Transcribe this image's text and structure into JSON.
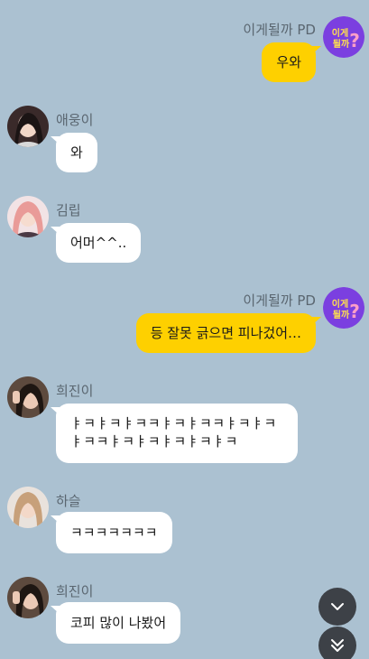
{
  "chat": {
    "messages": [
      {
        "sender": "이게될까 PD",
        "text": "우와",
        "side": "right"
      },
      {
        "sender": "애웅이",
        "text": "와",
        "side": "left"
      },
      {
        "sender": "김립",
        "text": "어머^^..",
        "side": "left"
      },
      {
        "sender": "이게될까 PD",
        "text": "등 잘못 긁으면 피나겄어…",
        "side": "right"
      },
      {
        "sender": "희진이",
        "text": "ㅑㅋㅑㅋㅑㅋㅋㅑㅋㅑㅋㅋㅑㅋㅑㅋㅑㅋㅋㅑㅋㅑㅋㅑㅋㅑㅋㅑㅋ",
        "side": "left"
      },
      {
        "sender": "하슬",
        "text": "ㅋㅋㅋㅋㅋㅋㅋ",
        "side": "left"
      },
      {
        "sender": "희진이",
        "text": "코피 많이 나봤어",
        "side": "left"
      }
    ],
    "pd_avatar_text": "이게될까"
  },
  "controls": {
    "scroll_down_icon": "chevron-down-icon",
    "scroll_bottom_icon": "double-chevron-down-icon"
  },
  "colors": {
    "background": "#abc1d1",
    "my_bubble": "#fed000",
    "their_bubble": "#ffffff",
    "name_text": "#5a6670",
    "pd_avatar": "#7b3fe0"
  }
}
